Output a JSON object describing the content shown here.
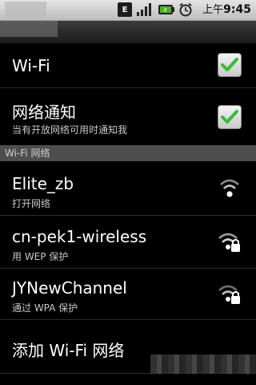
{
  "status_bar": {
    "network_type": "E",
    "clock_prefix": "上午",
    "clock_time": "9:45",
    "icons": [
      "edge-icon",
      "signal-icon",
      "battery-icon",
      "alarm-icon"
    ]
  },
  "settings": {
    "wifi": {
      "label": "Wi-Fi",
      "checked": true
    },
    "network_notification": {
      "label": "网络通知",
      "summary": "当有开放网络可用时通知我",
      "checked": true
    }
  },
  "section": {
    "header": "Wi-Fi 网络"
  },
  "networks": [
    {
      "ssid": "Elite_zb",
      "status": "打开网络",
      "secured": false
    },
    {
      "ssid": "cn-pek1-wireless",
      "status": "用 WEP 保护",
      "secured": true
    },
    {
      "ssid": "JYNewChannel",
      "status": "通过 WPA 保护",
      "secured": true
    }
  ],
  "add_network": {
    "label": "添加 Wi-Fi 网络"
  },
  "colors": {
    "check": "#3cb93c",
    "background": "#000000",
    "section_header": "#4e4e4e"
  }
}
